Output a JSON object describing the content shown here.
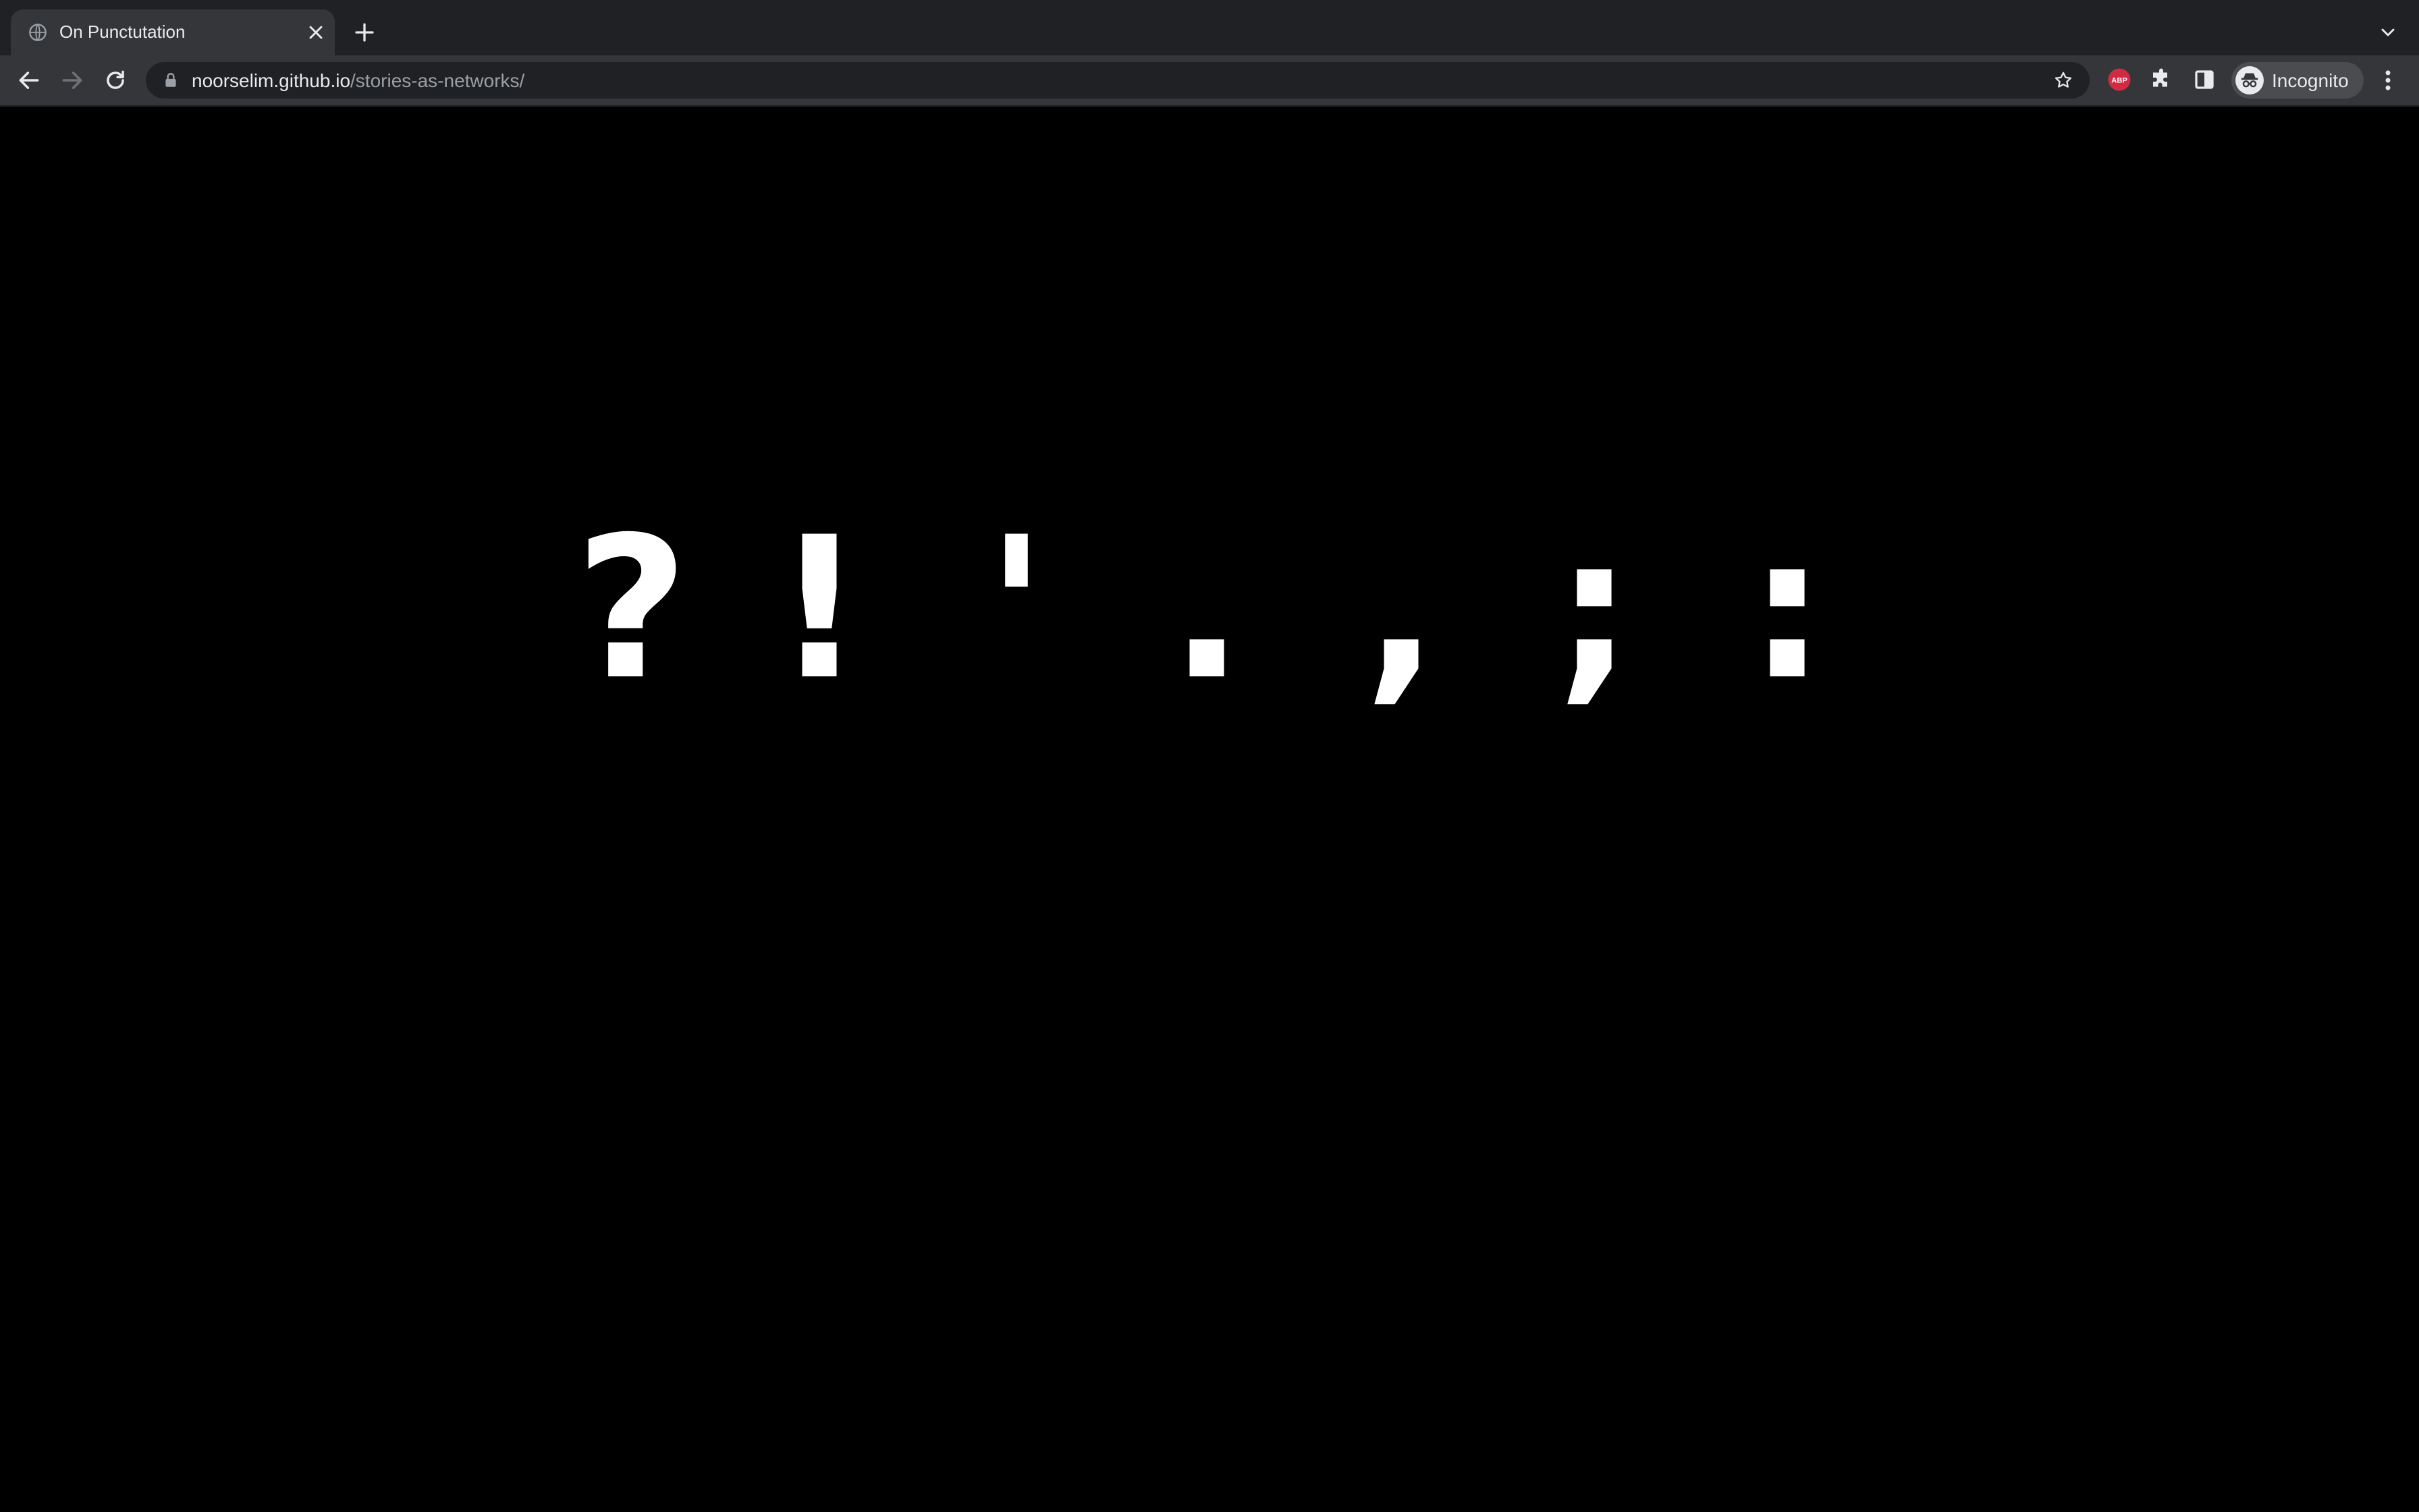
{
  "browser": {
    "tab": {
      "title": "On Punctutation",
      "favicon": "globe-icon"
    },
    "address_bar": {
      "host": "noorselim.github.io",
      "path": "/stories-as-networks/"
    },
    "extensions": {
      "adblock_label": "ABP"
    },
    "profile": {
      "label": "Incognito"
    },
    "colors": {
      "tabstrip": "#202124",
      "toolbar": "#35363a",
      "omnibox": "#202124",
      "page_background": "#000000",
      "text": "#ffffff",
      "abp_red": "#d12a43"
    }
  },
  "page": {
    "punctuation": [
      {
        "glyph": "?",
        "name": "question-mark"
      },
      {
        "glyph": "!",
        "name": "exclamation-mark"
      },
      {
        "glyph": "'",
        "name": "apostrophe"
      },
      {
        "glyph": ".",
        "name": "period"
      },
      {
        "glyph": ",",
        "name": "comma"
      },
      {
        "glyph": ";",
        "name": "semicolon"
      },
      {
        "glyph": ":",
        "name": "colon"
      }
    ]
  }
}
